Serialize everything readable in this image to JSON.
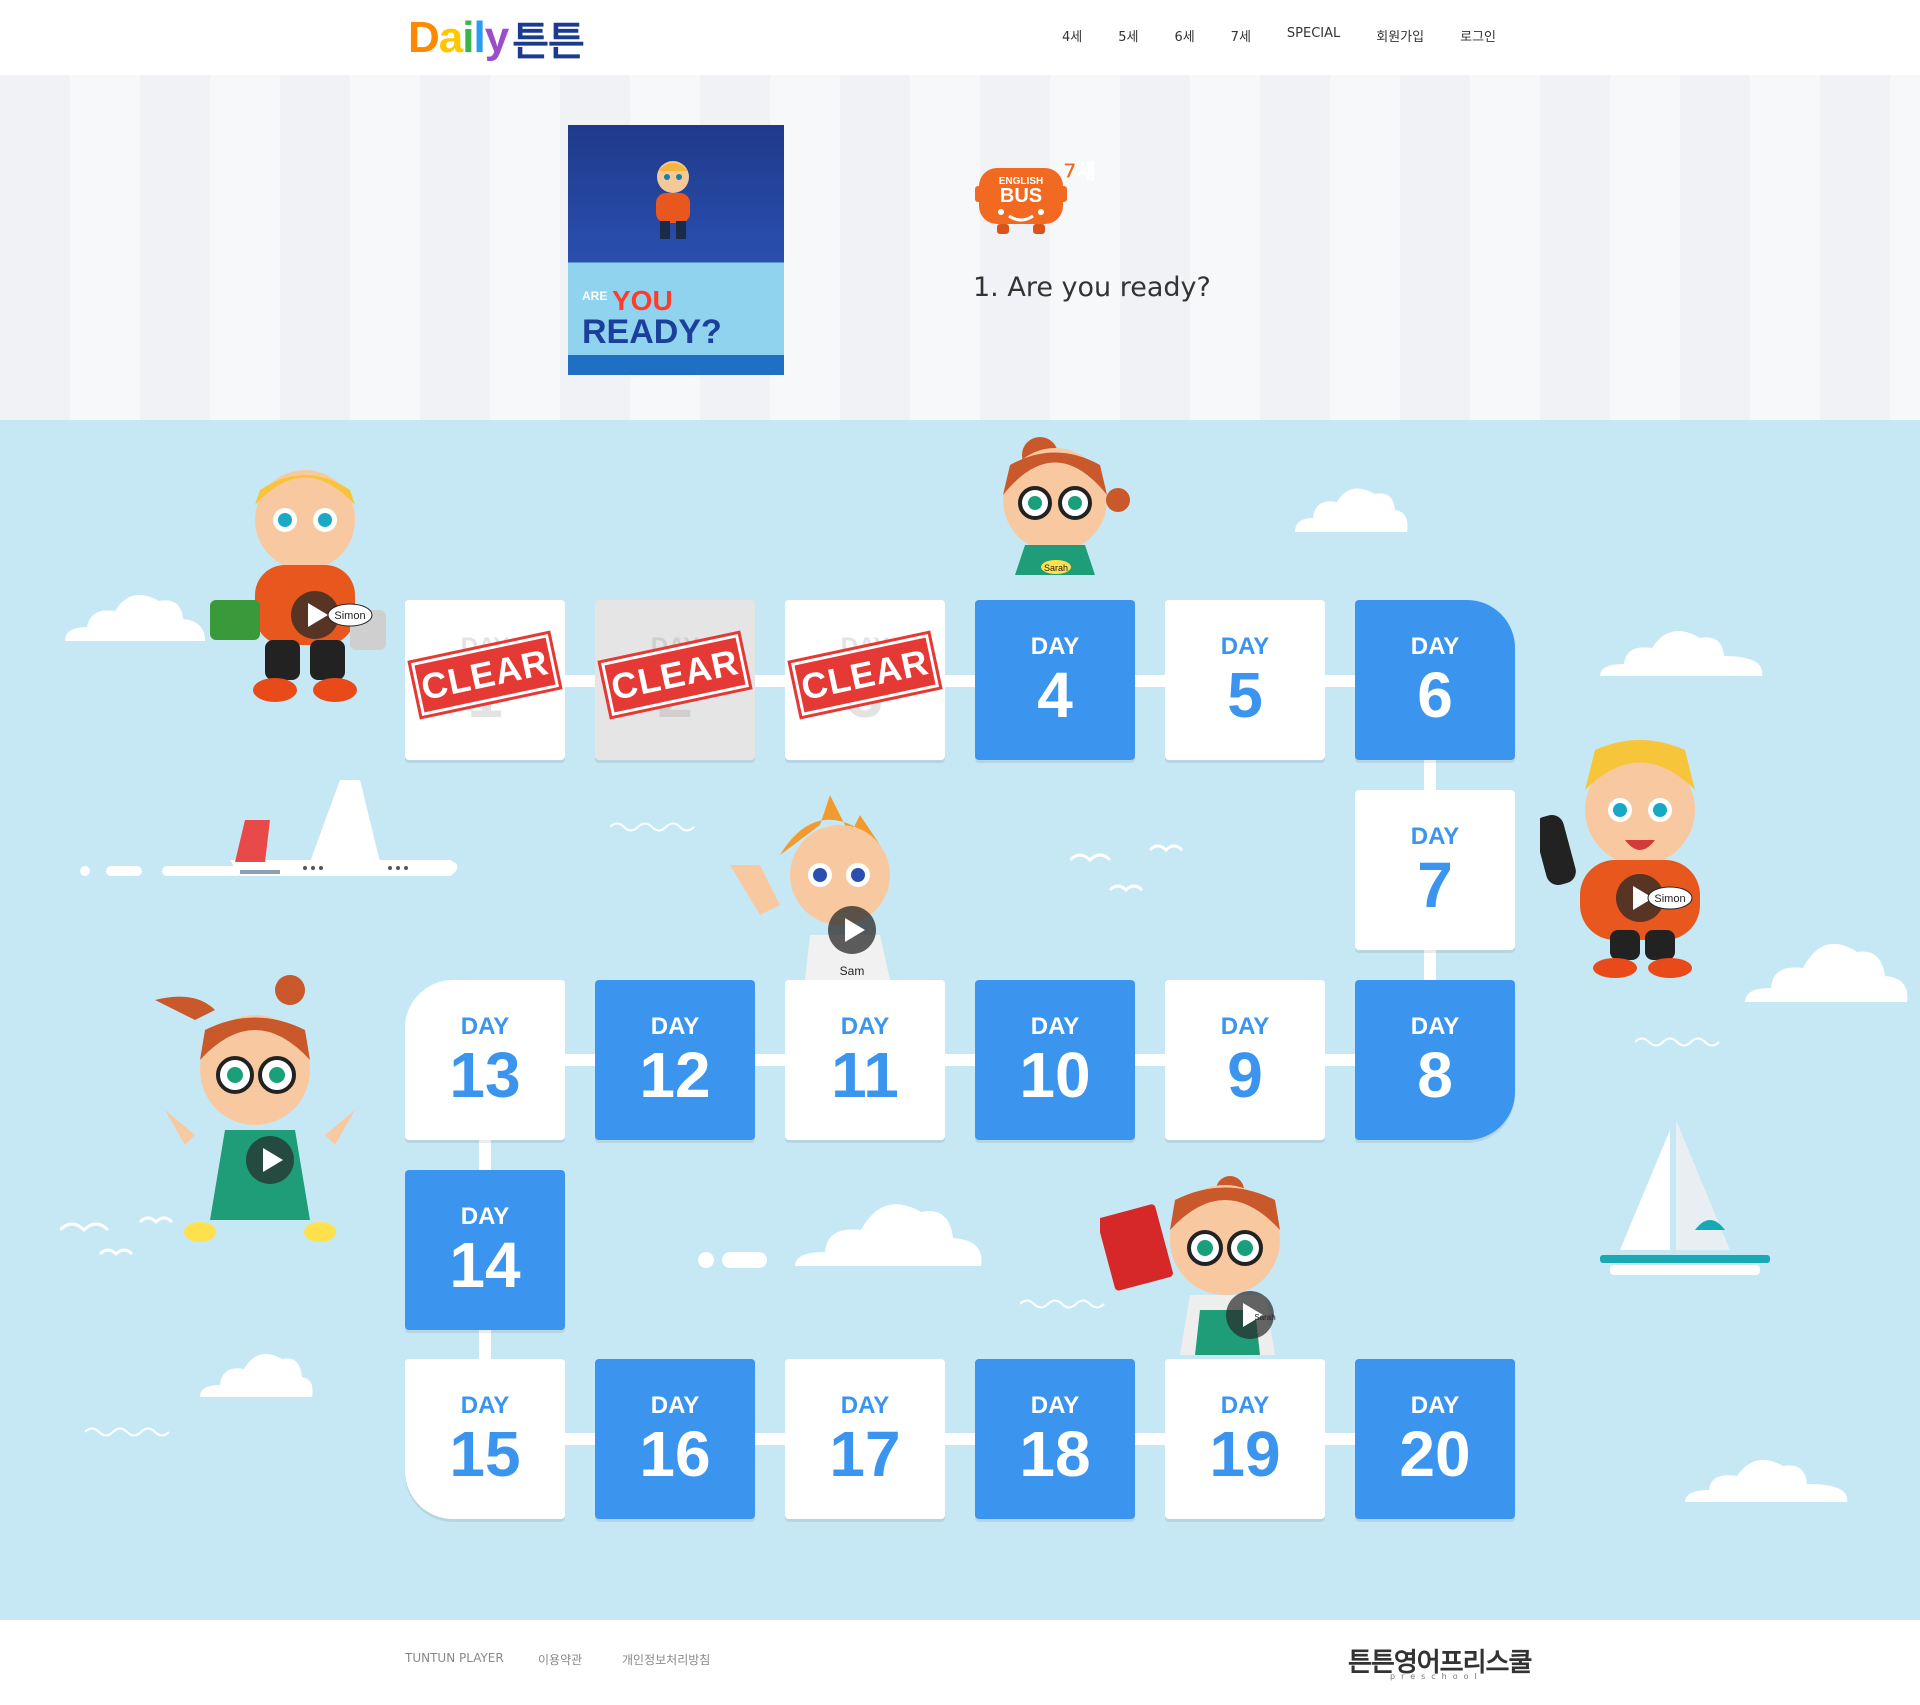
{
  "header": {
    "logo": {
      "letters": [
        "D",
        "a",
        "i",
        "l",
        "y"
      ],
      "korean": "튼튼"
    },
    "nav": [
      "4세",
      "5세",
      "6세",
      "7세",
      "SPECIAL",
      "회원가입",
      "로그인"
    ]
  },
  "book": {
    "cover": {
      "are": "ARE",
      "you": "YOU",
      "ready": "READY?"
    },
    "series_badge": {
      "line1": "ENGLISH",
      "line2": "BUS",
      "age": "7세"
    },
    "lesson_title": "1. Are you ready?"
  },
  "board": {
    "day_label": "DAY",
    "clear_label": "CLEAR",
    "days": [
      {
        "n": "1",
        "cleared": true
      },
      {
        "n": "2",
        "cleared": true
      },
      {
        "n": "3",
        "cleared": true
      },
      {
        "n": "4"
      },
      {
        "n": "5"
      },
      {
        "n": "6"
      },
      {
        "n": "7"
      },
      {
        "n": "8"
      },
      {
        "n": "9"
      },
      {
        "n": "10"
      },
      {
        "n": "11"
      },
      {
        "n": "12"
      },
      {
        "n": "13"
      },
      {
        "n": "14"
      },
      {
        "n": "15"
      },
      {
        "n": "16"
      },
      {
        "n": "17"
      },
      {
        "n": "18"
      },
      {
        "n": "19"
      },
      {
        "n": "20"
      }
    ],
    "characters": {
      "simon": "Simon",
      "sam": "Sam",
      "sarah": "Sarah"
    },
    "colors": {
      "tile_blue": "#3b95ee",
      "tile_white": "#ffffff",
      "board_bg": "#c6e8f4",
      "stamp_red": "#e53935"
    }
  },
  "footer": {
    "links": [
      "TUNTUN PLAYER",
      "이용약관",
      "개인정보처리방침"
    ],
    "logo_text": "튼튼영어프리스쿨",
    "logo_sub": "preschool"
  }
}
